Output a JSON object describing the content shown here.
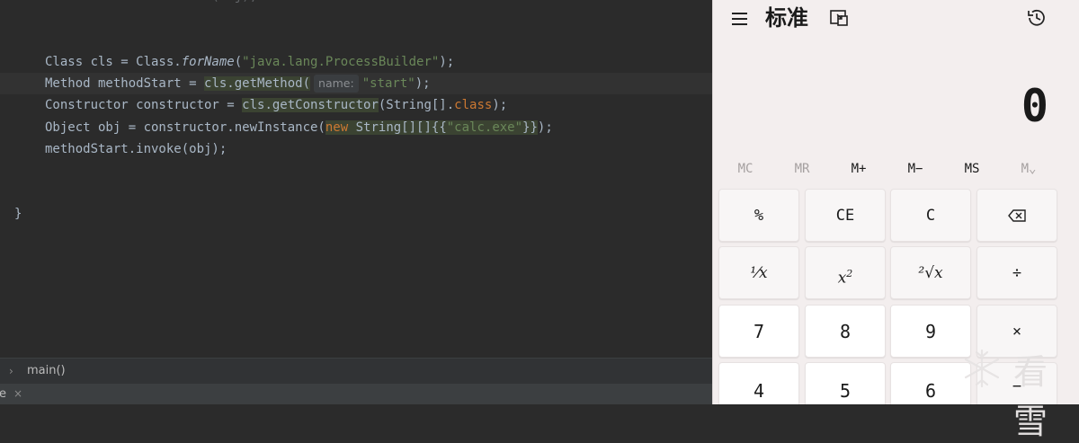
{
  "editor": {
    "cut_line": "    methodStart.invoke(obj);",
    "lines": {
      "l1": {
        "a": "Class cls = Class.",
        "b": "forName",
        "c": "(",
        "d": "\"java.lang.ProcessBuilder\"",
        "e": ");"
      },
      "l2": {
        "a": "Method methodStart = ",
        "b": "cls.getMethod(",
        "hint": "name:",
        "d": "\"start\"",
        "e": ");"
      },
      "l3": {
        "a": "Constructor constructor = ",
        "b": "cls.getConstructor",
        "c": "(String[].",
        "kw": "class",
        "e": ");"
      },
      "l4": {
        "a": "Object obj = constructor.newInstance(",
        "kw": "new",
        "b": " String[][]{{",
        "d": "\"calc.exe\"",
        "c": "}}",
        "e": ");"
      },
      "l5": {
        "a": "methodStart.invoke(obj);"
      },
      "closing_brace": "}"
    },
    "breadcrumb": "main()",
    "bottom_tab": "e",
    "bottom_tab_close": "×"
  },
  "calculator": {
    "title": "标准",
    "display": "0",
    "memory_buttons": [
      "MC",
      "MR",
      "M+",
      "M−",
      "MS",
      "M⌄"
    ],
    "keys": {
      "percent": "%",
      "ce": "CE",
      "c": "C",
      "reciprocal": "¹⁄x",
      "square": "x",
      "square_sup": "2",
      "sqrt": "²√x",
      "divide": "÷",
      "seven": "7",
      "eight": "8",
      "nine": "9",
      "multiply": "×",
      "four": "4",
      "five": "5",
      "six": "6",
      "minus": "−"
    }
  },
  "watermark": "看雪"
}
